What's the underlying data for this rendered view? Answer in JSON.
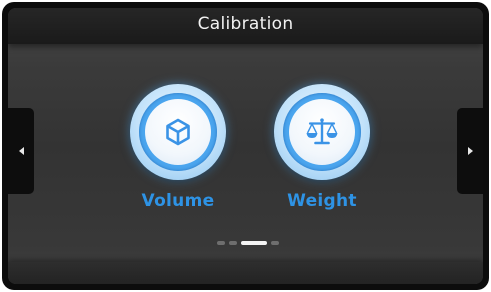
{
  "header": {
    "title": "Calibration"
  },
  "options": [
    {
      "label": "Volume",
      "icon": "cube-icon"
    },
    {
      "label": "Weight",
      "icon": "balance-scale-icon"
    }
  ],
  "pager": {
    "total_pages": 4,
    "active_index": 2
  },
  "navigation": {
    "left_icon": "triangle-left-icon",
    "right_icon": "triangle-right-icon"
  },
  "colors": {
    "accent": "#2e93e5",
    "icon_blue": "#3a93e6",
    "title_text": "#f2f2f2",
    "background": "#363636"
  }
}
